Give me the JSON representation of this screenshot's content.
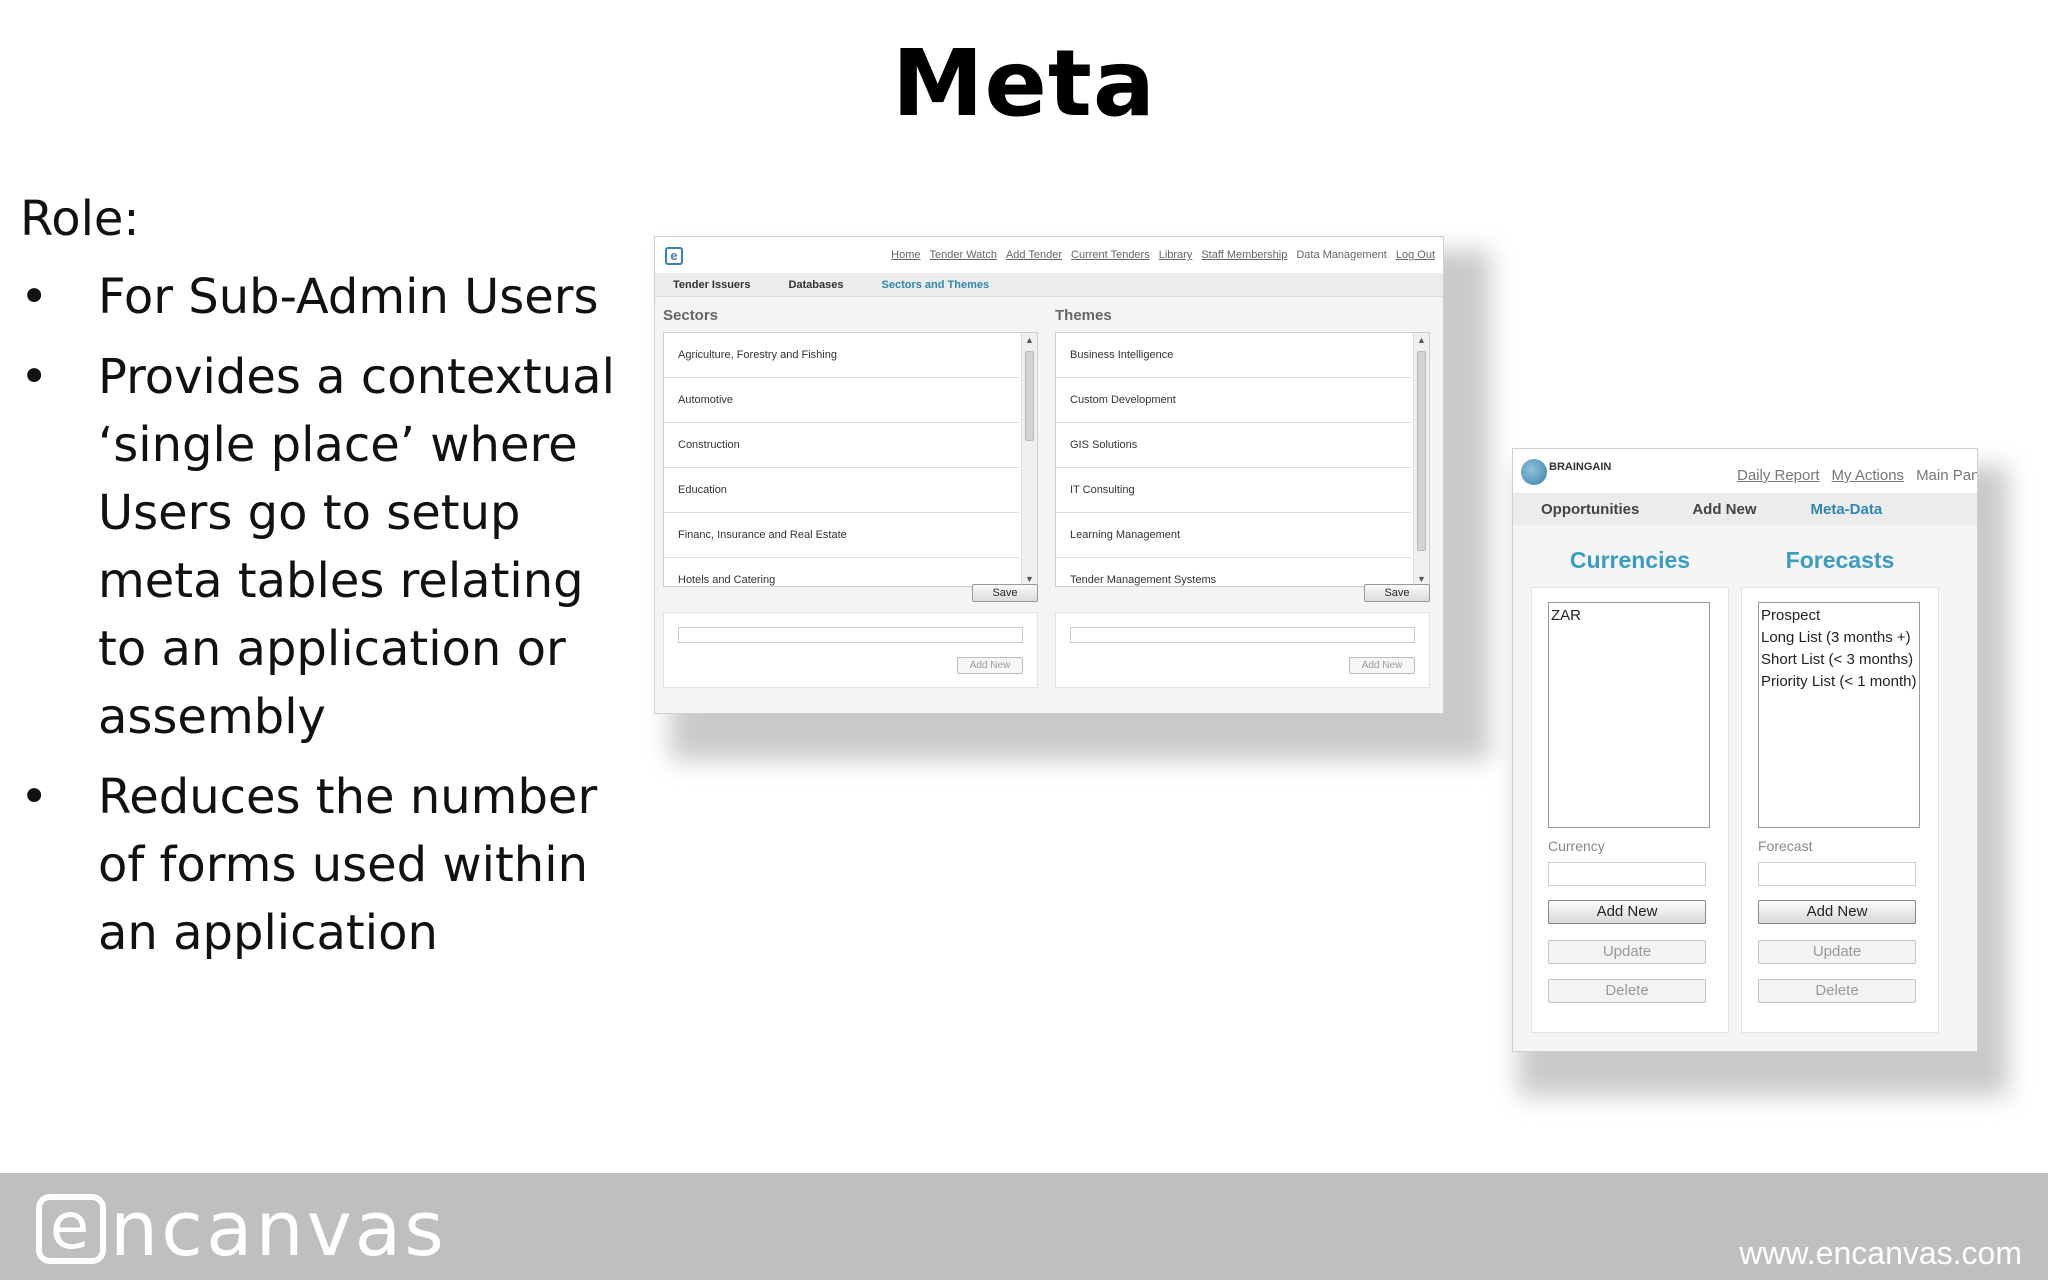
{
  "slide": {
    "title": "Meta",
    "role_label": "Role:",
    "bullet_symbol": "•",
    "bullets": [
      "For Sub-Admin Users",
      "Provides a contextual ‘single place’ where Users go  to setup meta tables relating to an application or assembly",
      "Reduces the number of forms used within an application"
    ]
  },
  "screenshot1": {
    "logo_glyph": "e",
    "nav": [
      "Home",
      "Tender Watch",
      "Add Tender",
      "Current Tenders",
      "Library",
      "Staff Membership",
      "Data Management",
      "Log Out"
    ],
    "tabs": [
      "Tender Issuers",
      "Databases",
      "Sectors and Themes"
    ],
    "sectors": {
      "title": "Sectors",
      "items": [
        "Agriculture, Forestry and Fishing",
        "Automotive",
        "Construction",
        "Education",
        "Financ, Insurance and Real Estate",
        "Hotels and Catering"
      ],
      "save_label": "Save",
      "add_new_label": "Add New"
    },
    "themes": {
      "title": "Themes",
      "items": [
        "Business Intelligence",
        "Custom Development",
        "GIS Solutions",
        "IT Consulting",
        "Learning Management",
        "Tender Management Systems"
      ],
      "save_label": "Save",
      "add_new_label": "Add New"
    }
  },
  "screenshot2": {
    "logo_text": "BRAINGAIN",
    "nav": [
      "Daily Report",
      "My Actions",
      "Main Pan"
    ],
    "tabs": [
      "Opportunities",
      "Add New",
      "Meta-Data"
    ],
    "currencies": {
      "heading": "Currencies",
      "items": [
        "ZAR"
      ],
      "field_label": "Currency",
      "add_new": "Add New",
      "update": "Update",
      "delete": "Delete"
    },
    "forecasts": {
      "heading": "Forecasts",
      "items": [
        "Prospect",
        "Long List (3 months +)",
        "Short List (< 3 months)",
        "Priority List (< 1 month)"
      ],
      "field_label": "Forecast",
      "add_new": "Add New",
      "update": "Update",
      "delete": "Delete"
    }
  },
  "footer": {
    "logo_e": "e",
    "logo_rest": "ncanvas",
    "url": "www.encanvas.com"
  }
}
